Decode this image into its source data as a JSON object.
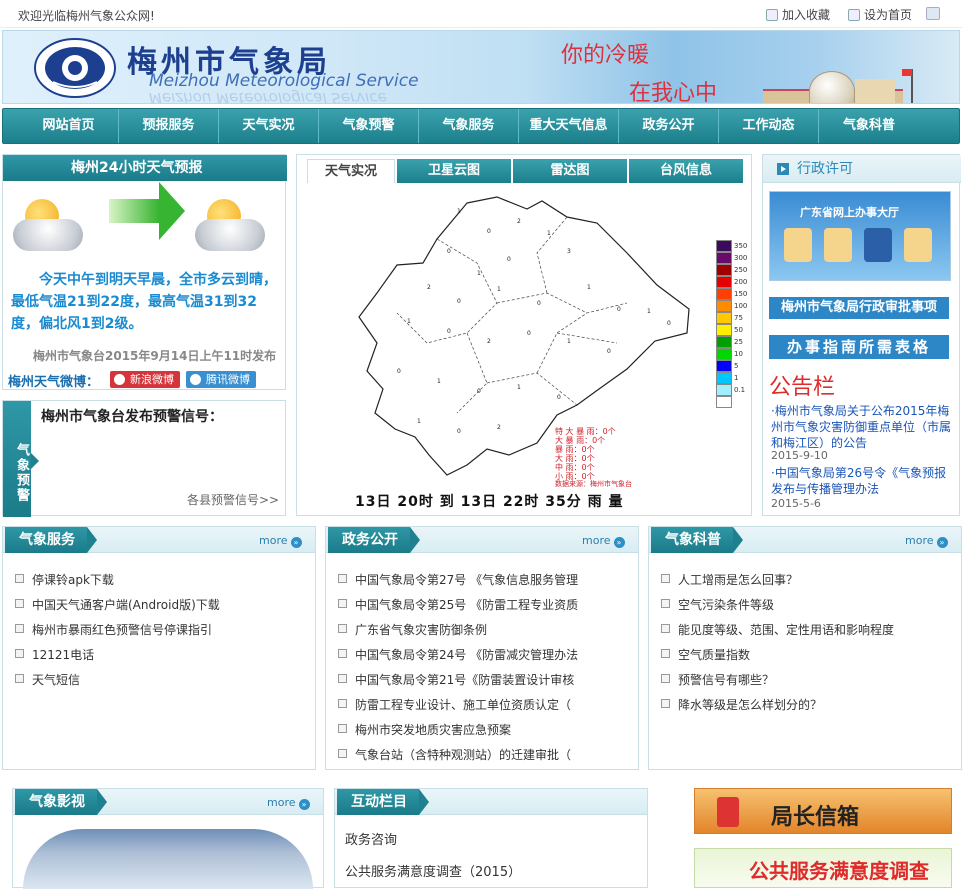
{
  "topbar": {
    "welcome": "欢迎光临梅州气象公众网!",
    "favorite": "加入收藏",
    "set_home": "设为首页"
  },
  "banner": {
    "title_cn": "梅州市气象局",
    "title_en": "Meizhou  Meteorological Service",
    "slogan_1": "你的冷暖",
    "slogan_2": "在我心中"
  },
  "nav": [
    "网站首页",
    "预报服务",
    "天气实况",
    "气象预警",
    "气象服务",
    "重大天气信息",
    "政务公开",
    "工作动态",
    "气象科普"
  ],
  "forecast": {
    "title": "梅州24小时天气预报",
    "text": "今天中午到明天早晨，全市多云到晴，最低气温21到22度，最高气温31到32度，偏北风1到2级。",
    "published": "梅州市气象台2015年9月14日上午11时发布",
    "weibo_label": "梅州天气微博：",
    "sina": "新浪微博",
    "tencent": "腾讯微博"
  },
  "warning": {
    "side": "气象预警",
    "title": "梅州市气象台发布预警信号：",
    "more": "各县预警信号>>"
  },
  "center": {
    "tabs": [
      "天气实况",
      "卫星云图",
      "雷达图",
      "台风信息"
    ],
    "legend": [
      "350",
      "300",
      "250",
      "200",
      "150",
      "100",
      "75",
      "50",
      "25",
      "10",
      "5",
      "1",
      "0.1"
    ],
    "bottom_text": "13日 20时 到 13日 22时 35分 雨 量",
    "stats": [
      "特 大 暴 雨：0个",
      "大 暴 雨：0个",
      "暴 雨：0个",
      "大 雨：0个",
      "中 雨：0个",
      "小 雨：0个"
    ],
    "source": "数据来源：梅州市气象台"
  },
  "right": {
    "header": "行政许可",
    "gd_title": "广东省网上办事大厅",
    "approval": "梅州市气象局行政审批事项",
    "guide": "办事指南所需表格",
    "board": "公告栏",
    "notices": [
      {
        "text": "·梅州市气象局关于公布2015年梅州市气象灾害防御重点单位（市属和梅江区）的公告",
        "date": "2015-9-10"
      },
      {
        "text": "·中国气象局第26号令《气象预报发布与传播管理办法",
        "date": "2015-5-6"
      }
    ]
  },
  "lists": [
    {
      "title": "气象服务",
      "more": "more",
      "items": [
        "停课铃apk下载",
        "中国天气通客户端(Android版)下载",
        "梅州市暴雨红色预警信号停课指引",
        "12121电话",
        "天气短信"
      ]
    },
    {
      "title": "政务公开",
      "more": "more",
      "items": [
        "中国气象局令第27号 《气象信息服务管理",
        "中国气象局令第25号 《防雷工程专业资质",
        "广东省气象灾害防御条例",
        "中国气象局令第24号 《防雷减灾管理办法",
        "中国气象局令第21号《防雷装置设计审核",
        "防雷工程专业设计、施工单位资质认定（",
        "梅州市突发地质灾害应急预案",
        "气象台站（含特种观测站）的迁建审批（"
      ]
    },
    {
      "title": "气象科普",
      "more": "more",
      "items": [
        "人工增雨是怎么回事？",
        "空气污染条件等级",
        "能见度等级、范围、定性用语和影响程度",
        "空气质量指数",
        "预警信号有哪些？",
        "降水等级是怎么样划分的？"
      ]
    }
  ],
  "video": {
    "title": "气象影视",
    "more": "more"
  },
  "interactive": {
    "title": "互动栏目",
    "items": [
      "政务咨询",
      "公共服务满意度调查（2015）"
    ]
  },
  "mailbox": "局长信箱",
  "survey": "公共服务满意度调查",
  "colors": {
    "nav": "#1c7f8c",
    "accent": "#2d86c6",
    "alert": "#e02b2b"
  }
}
